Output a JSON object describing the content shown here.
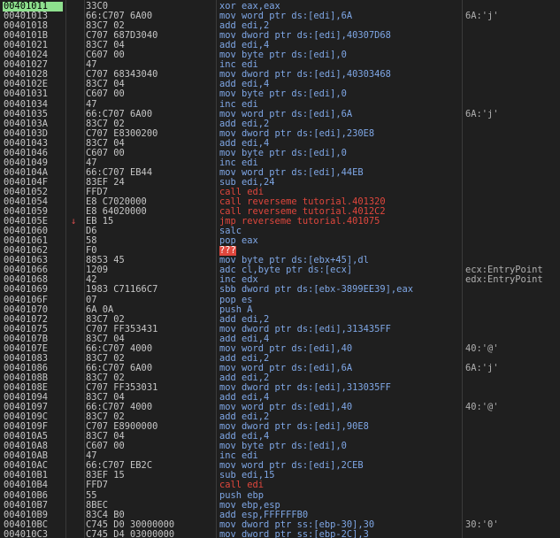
{
  "colors": {
    "background": "#1f1f1f",
    "selected_address_bg": "#8ee08e",
    "instr_blue": "#7fa7e6",
    "instr_red": "#e0473d",
    "text": "#c6c6c6",
    "jump_arrow": "#e05050"
  },
  "rows": [
    {
      "addr": "00401011",
      "bytes": "33C0",
      "instr": "xor eax,eax",
      "comment": "",
      "style": "blue",
      "selected": true,
      "arrow": ""
    },
    {
      "addr": "00401013",
      "bytes": "66:C707 6A00",
      "instr": "mov word ptr ds:[edi],6A",
      "comment": "6A:'j'",
      "style": "blue",
      "arrow": ""
    },
    {
      "addr": "00401018",
      "bytes": "83C7 02",
      "instr": "add edi,2",
      "comment": "",
      "style": "blue",
      "arrow": ""
    },
    {
      "addr": "0040101B",
      "bytes": "C707 687D3040",
      "instr": "mov dword ptr ds:[edi],40307D68",
      "comment": "",
      "style": "blue",
      "arrow": ""
    },
    {
      "addr": "00401021",
      "bytes": "83C7 04",
      "instr": "add edi,4",
      "comment": "",
      "style": "blue",
      "arrow": ""
    },
    {
      "addr": "00401024",
      "bytes": "C607 00",
      "instr": "mov byte ptr ds:[edi],0",
      "comment": "",
      "style": "blue",
      "arrow": ""
    },
    {
      "addr": "00401027",
      "bytes": "47",
      "instr": "inc edi",
      "comment": "",
      "style": "blue",
      "arrow": ""
    },
    {
      "addr": "00401028",
      "bytes": "C707 68343040",
      "instr": "mov dword ptr ds:[edi],40303468",
      "comment": "",
      "style": "blue",
      "arrow": ""
    },
    {
      "addr": "0040102E",
      "bytes": "83C7 04",
      "instr": "add edi,4",
      "comment": "",
      "style": "blue",
      "arrow": ""
    },
    {
      "addr": "00401031",
      "bytes": "C607 00",
      "instr": "mov byte ptr ds:[edi],0",
      "comment": "",
      "style": "blue",
      "arrow": ""
    },
    {
      "addr": "00401034",
      "bytes": "47",
      "instr": "inc edi",
      "comment": "",
      "style": "blue",
      "arrow": ""
    },
    {
      "addr": "00401035",
      "bytes": "66:C707 6A00",
      "instr": "mov word ptr ds:[edi],6A",
      "comment": "6A:'j'",
      "style": "blue",
      "arrow": ""
    },
    {
      "addr": "0040103A",
      "bytes": "83C7 02",
      "instr": "add edi,2",
      "comment": "",
      "style": "blue",
      "arrow": ""
    },
    {
      "addr": "0040103D",
      "bytes": "C707 E8300200",
      "instr": "mov dword ptr ds:[edi],230E8",
      "comment": "",
      "style": "blue",
      "arrow": ""
    },
    {
      "addr": "00401043",
      "bytes": "83C7 04",
      "instr": "add edi,4",
      "comment": "",
      "style": "blue",
      "arrow": ""
    },
    {
      "addr": "00401046",
      "bytes": "C607 00",
      "instr": "mov byte ptr ds:[edi],0",
      "comment": "",
      "style": "blue",
      "arrow": ""
    },
    {
      "addr": "00401049",
      "bytes": "47",
      "instr": "inc edi",
      "comment": "",
      "style": "blue",
      "arrow": ""
    },
    {
      "addr": "0040104A",
      "bytes": "66:C707 EB44",
      "instr": "mov word ptr ds:[edi],44EB",
      "comment": "",
      "style": "blue",
      "arrow": ""
    },
    {
      "addr": "0040104F",
      "bytes": "83EF 24",
      "instr": "sub edi,24",
      "comment": "",
      "style": "blue",
      "arrow": ""
    },
    {
      "addr": "00401052",
      "bytes": "FFD7",
      "instr": "call edi",
      "comment": "",
      "style": "red",
      "arrow": ""
    },
    {
      "addr": "00401054",
      "bytes": "E8 C7020000",
      "instr": "call reverseme tutorial.401320",
      "comment": "",
      "style": "red",
      "arrow": ""
    },
    {
      "addr": "00401059",
      "bytes": "E8 64020000",
      "instr": "call reverseme tutorial.4012C2",
      "comment": "",
      "style": "red",
      "arrow": ""
    },
    {
      "addr": "0040105E",
      "bytes": "EB 15",
      "instr": "jmp reverseme tutorial.401075",
      "comment": "",
      "style": "red",
      "arrow": "↓"
    },
    {
      "addr": "00401060",
      "bytes": "D6",
      "instr": "salc",
      "comment": "",
      "style": "blue",
      "arrow": ""
    },
    {
      "addr": "00401061",
      "bytes": "58",
      "instr": "pop eax",
      "comment": "",
      "style": "blue",
      "arrow": ""
    },
    {
      "addr": "00401062",
      "bytes": "F0",
      "instr": "???",
      "comment": "",
      "style": "bad",
      "arrow": ""
    },
    {
      "addr": "00401063",
      "bytes": "8853 45",
      "instr": "mov byte ptr ds:[ebx+45],dl",
      "comment": "",
      "style": "blue",
      "arrow": ""
    },
    {
      "addr": "00401066",
      "bytes": "1209",
      "instr": "adc cl,byte ptr ds:[ecx]",
      "comment": "ecx:EntryPoint",
      "style": "blue",
      "arrow": ""
    },
    {
      "addr": "00401068",
      "bytes": "42",
      "instr": "inc edx",
      "comment": "edx:EntryPoint",
      "style": "blue",
      "arrow": ""
    },
    {
      "addr": "00401069",
      "bytes": "1983 C71166C7",
      "instr": "sbb dword ptr ds:[ebx-3899EE39],eax",
      "comment": "",
      "style": "blue",
      "arrow": ""
    },
    {
      "addr": "0040106F",
      "bytes": "07",
      "instr": "pop es",
      "comment": "",
      "style": "blue",
      "arrow": ""
    },
    {
      "addr": "00401070",
      "bytes": "6A 0A",
      "instr": "push A",
      "comment": "",
      "style": "blue",
      "arrow": ""
    },
    {
      "addr": "00401072",
      "bytes": "83C7 02",
      "instr": "add edi,2",
      "comment": "",
      "style": "blue",
      "arrow": ""
    },
    {
      "addr": "00401075",
      "bytes": "C707 FF353431",
      "instr": "mov dword ptr ds:[edi],313435FF",
      "comment": "",
      "style": "blue",
      "arrow": ""
    },
    {
      "addr": "0040107B",
      "bytes": "83C7 04",
      "instr": "add edi,4",
      "comment": "",
      "style": "blue",
      "arrow": ""
    },
    {
      "addr": "0040107E",
      "bytes": "66:C707 4000",
      "instr": "mov word ptr ds:[edi],40",
      "comment": "40:'@'",
      "style": "blue",
      "arrow": ""
    },
    {
      "addr": "00401083",
      "bytes": "83C7 02",
      "instr": "add edi,2",
      "comment": "",
      "style": "blue",
      "arrow": ""
    },
    {
      "addr": "00401086",
      "bytes": "66:C707 6A00",
      "instr": "mov word ptr ds:[edi],6A",
      "comment": "6A:'j'",
      "style": "blue",
      "arrow": ""
    },
    {
      "addr": "0040108B",
      "bytes": "83C7 02",
      "instr": "add edi,2",
      "comment": "",
      "style": "blue",
      "arrow": ""
    },
    {
      "addr": "0040108E",
      "bytes": "C707 FF353031",
      "instr": "mov dword ptr ds:[edi],313035FF",
      "comment": "",
      "style": "blue",
      "arrow": ""
    },
    {
      "addr": "00401094",
      "bytes": "83C7 04",
      "instr": "add edi,4",
      "comment": "",
      "style": "blue",
      "arrow": ""
    },
    {
      "addr": "00401097",
      "bytes": "66:C707 4000",
      "instr": "mov word ptr ds:[edi],40",
      "comment": "40:'@'",
      "style": "blue",
      "arrow": ""
    },
    {
      "addr": "0040109C",
      "bytes": "83C7 02",
      "instr": "add edi,2",
      "comment": "",
      "style": "blue",
      "arrow": ""
    },
    {
      "addr": "0040109F",
      "bytes": "C707 E8900000",
      "instr": "mov dword ptr ds:[edi],90E8",
      "comment": "",
      "style": "blue",
      "arrow": ""
    },
    {
      "addr": "004010A5",
      "bytes": "83C7 04",
      "instr": "add edi,4",
      "comment": "",
      "style": "blue",
      "arrow": ""
    },
    {
      "addr": "004010A8",
      "bytes": "C607 00",
      "instr": "mov byte ptr ds:[edi],0",
      "comment": "",
      "style": "blue",
      "arrow": ""
    },
    {
      "addr": "004010AB",
      "bytes": "47",
      "instr": "inc edi",
      "comment": "",
      "style": "blue",
      "arrow": ""
    },
    {
      "addr": "004010AC",
      "bytes": "66:C707 EB2C",
      "instr": "mov word ptr ds:[edi],2CEB",
      "comment": "",
      "style": "blue",
      "arrow": ""
    },
    {
      "addr": "004010B1",
      "bytes": "83EF 15",
      "instr": "sub edi,15",
      "comment": "",
      "style": "blue",
      "arrow": ""
    },
    {
      "addr": "004010B4",
      "bytes": "FFD7",
      "instr": "call edi",
      "comment": "",
      "style": "red",
      "arrow": ""
    },
    {
      "addr": "004010B6",
      "bytes": "55",
      "instr": "push ebp",
      "comment": "",
      "style": "blue",
      "arrow": ""
    },
    {
      "addr": "004010B7",
      "bytes": "8BEC",
      "instr": "mov ebp,esp",
      "comment": "",
      "style": "blue",
      "arrow": ""
    },
    {
      "addr": "004010B9",
      "bytes": "83C4 B0",
      "instr": "add esp,FFFFFFB0",
      "comment": "",
      "style": "blue",
      "arrow": ""
    },
    {
      "addr": "004010BC",
      "bytes": "C745 D0 30000000",
      "instr": "mov dword ptr ss:[ebp-30],30",
      "comment": "30:'0'",
      "style": "blue",
      "arrow": ""
    },
    {
      "addr": "004010C3",
      "bytes": "C745 D4 03000000",
      "instr": "mov dword ptr ss:[ebp-2C],3",
      "comment": "",
      "style": "blue",
      "arrow": ""
    }
  ]
}
